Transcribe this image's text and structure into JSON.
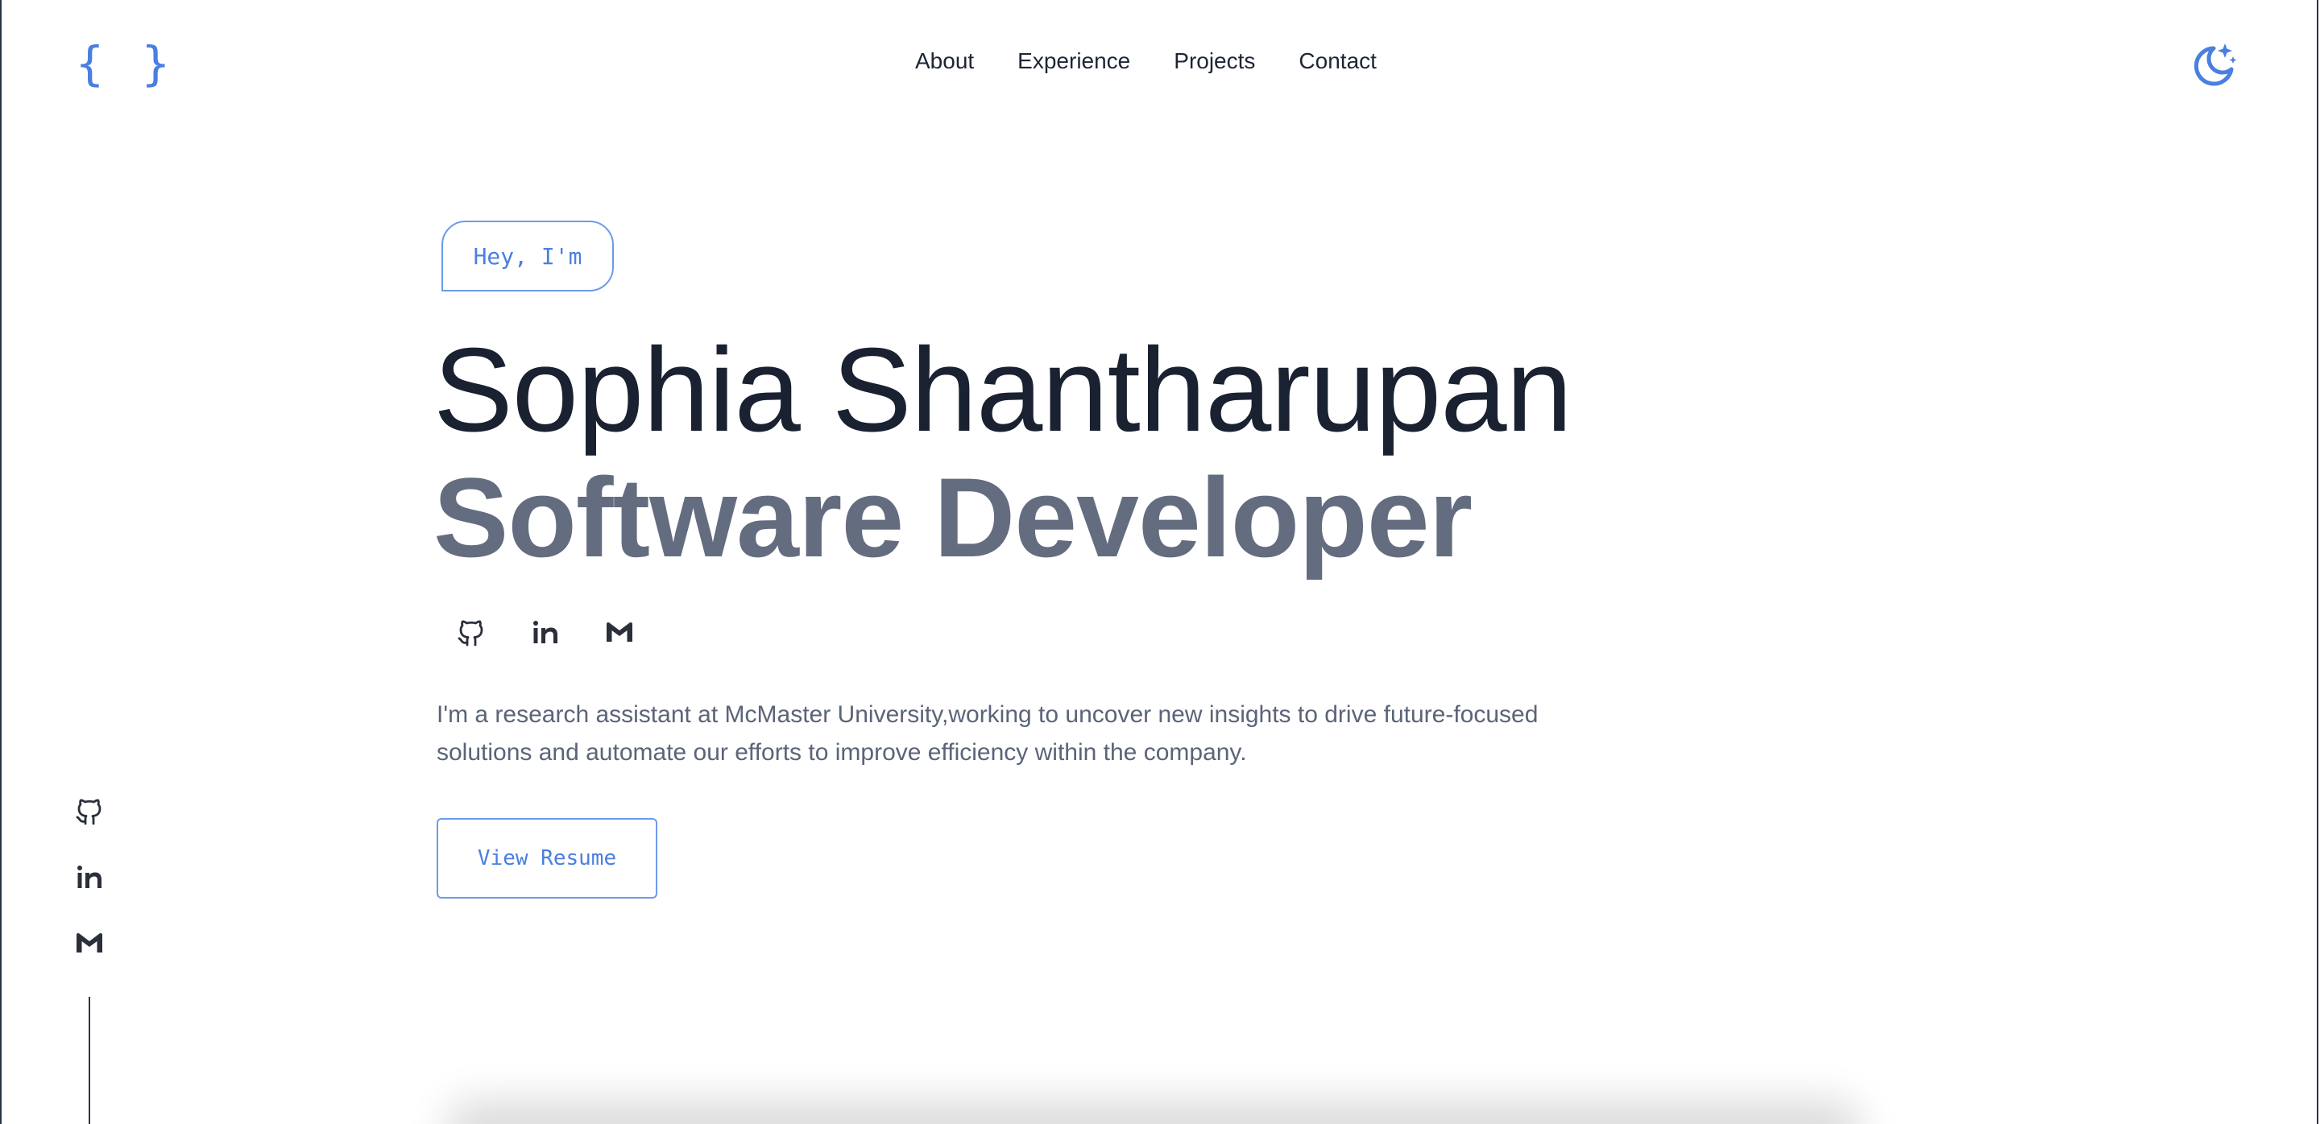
{
  "header": {
    "logo_text": "{ }",
    "nav": [
      {
        "label": "About"
      },
      {
        "label": "Experience"
      },
      {
        "label": "Projects"
      },
      {
        "label": "Contact"
      }
    ],
    "theme_icon": "moon-stars-icon"
  },
  "hero": {
    "greeting": "Hey, I'm",
    "name": "Sophia Shantharupan",
    "role": "Software Developer",
    "socials": [
      {
        "icon": "github-icon"
      },
      {
        "icon": "linkedin-icon"
      },
      {
        "icon": "gmail-icon"
      }
    ],
    "bio": "I'm a research assistant at McMaster University,working to uncover new insights to drive future-focused solutions and automate our efforts to improve efficiency within the company.",
    "resume_label": "View Resume"
  },
  "side_rail": {
    "socials": [
      {
        "icon": "github-icon"
      },
      {
        "icon": "linkedin-icon"
      },
      {
        "icon": "gmail-icon"
      }
    ]
  },
  "colors": {
    "accent": "#4a7fe0",
    "heading": "#1a2131",
    "subheading": "#646c80",
    "body_text": "#5b6478"
  }
}
